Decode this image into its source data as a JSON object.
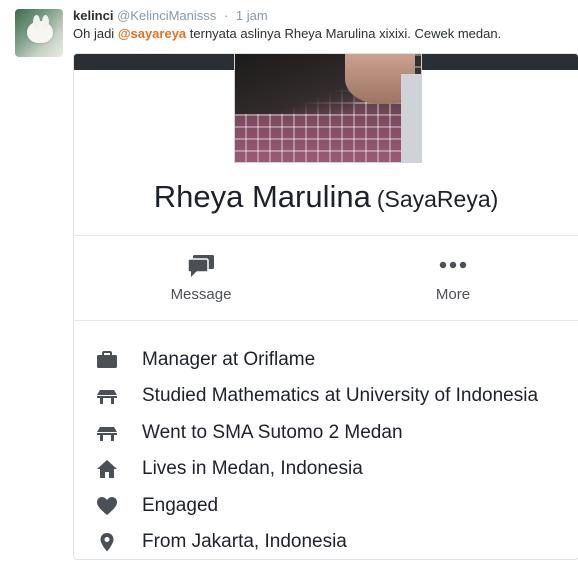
{
  "tweet": {
    "display_name": "kelinci",
    "handle": "@KelinciManisss",
    "separator": "·",
    "time": "1 jam",
    "text_before": "Oh jadi ",
    "mention": "@sayareya",
    "text_after": " ternyata aslinya Rheya Marulina xixixi. Cewek medan."
  },
  "card": {
    "full_name": "Rheya Marulina",
    "alias": "(SayaReya)",
    "actions": [
      {
        "label": "Message",
        "icon": "message-icon"
      },
      {
        "label": "More",
        "icon": "more-icon"
      }
    ],
    "info": [
      {
        "icon": "briefcase-icon",
        "text": "Manager at Oriflame"
      },
      {
        "icon": "school-icon",
        "text": "Studied Mathematics at University of Indonesia"
      },
      {
        "icon": "school-icon",
        "text": "Went to SMA Sutomo 2 Medan"
      },
      {
        "icon": "home-icon",
        "text": "Lives in Medan, Indonesia"
      },
      {
        "icon": "heart-icon",
        "text": "Engaged"
      },
      {
        "icon": "location-pin-icon",
        "text": "From Jakarta, Indonesia"
      }
    ]
  },
  "colors": {
    "mention": "#e0731f",
    "handle": "#8899a6",
    "icon": "#4b4f56",
    "cover": "#2b2e33"
  }
}
